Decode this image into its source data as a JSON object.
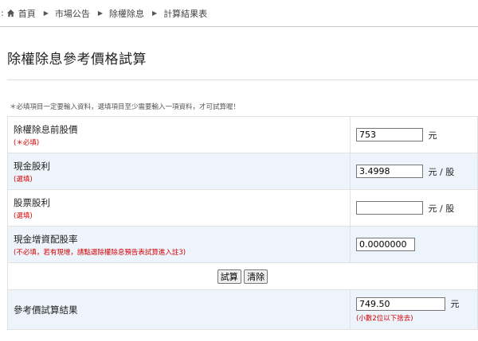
{
  "breadcrumb": {
    "colon": ":",
    "items": [
      "首頁",
      "市場公告",
      "除權除息",
      "計算結果表"
    ]
  },
  "page_title": "除權除息參考價格試算",
  "note": "＊必填項目一定要輸入資料，選填項目至少需要輸入一項資料，才可試算喔！",
  "rows": [
    {
      "label": "除權除息前股價",
      "sub": "(＊必填)",
      "value": "753",
      "unit": "元"
    },
    {
      "label": "現金股利",
      "sub": "(選填)",
      "value": "3.4998",
      "unit": "元 / 股"
    },
    {
      "label": "股票股利",
      "sub": "(選填)",
      "value": "",
      "unit": "元 / 股"
    },
    {
      "label": "現金增資配股率",
      "sub": "(不必填，若有現增，請點選除權除息預告表試算進入註3)",
      "value": "0.0000000",
      "unit": ""
    }
  ],
  "buttons": {
    "calc": "試算",
    "clear": "清除"
  },
  "result": {
    "label": "參考價試算結果",
    "value": "749.50",
    "unit": "元",
    "note": "(小數2位以下捨去)"
  },
  "colors": {
    "required_red": "#d40000",
    "row_blue": "#eef4fb"
  },
  "icons": {
    "home": "home-icon",
    "separator": "triangle-right-icon"
  }
}
